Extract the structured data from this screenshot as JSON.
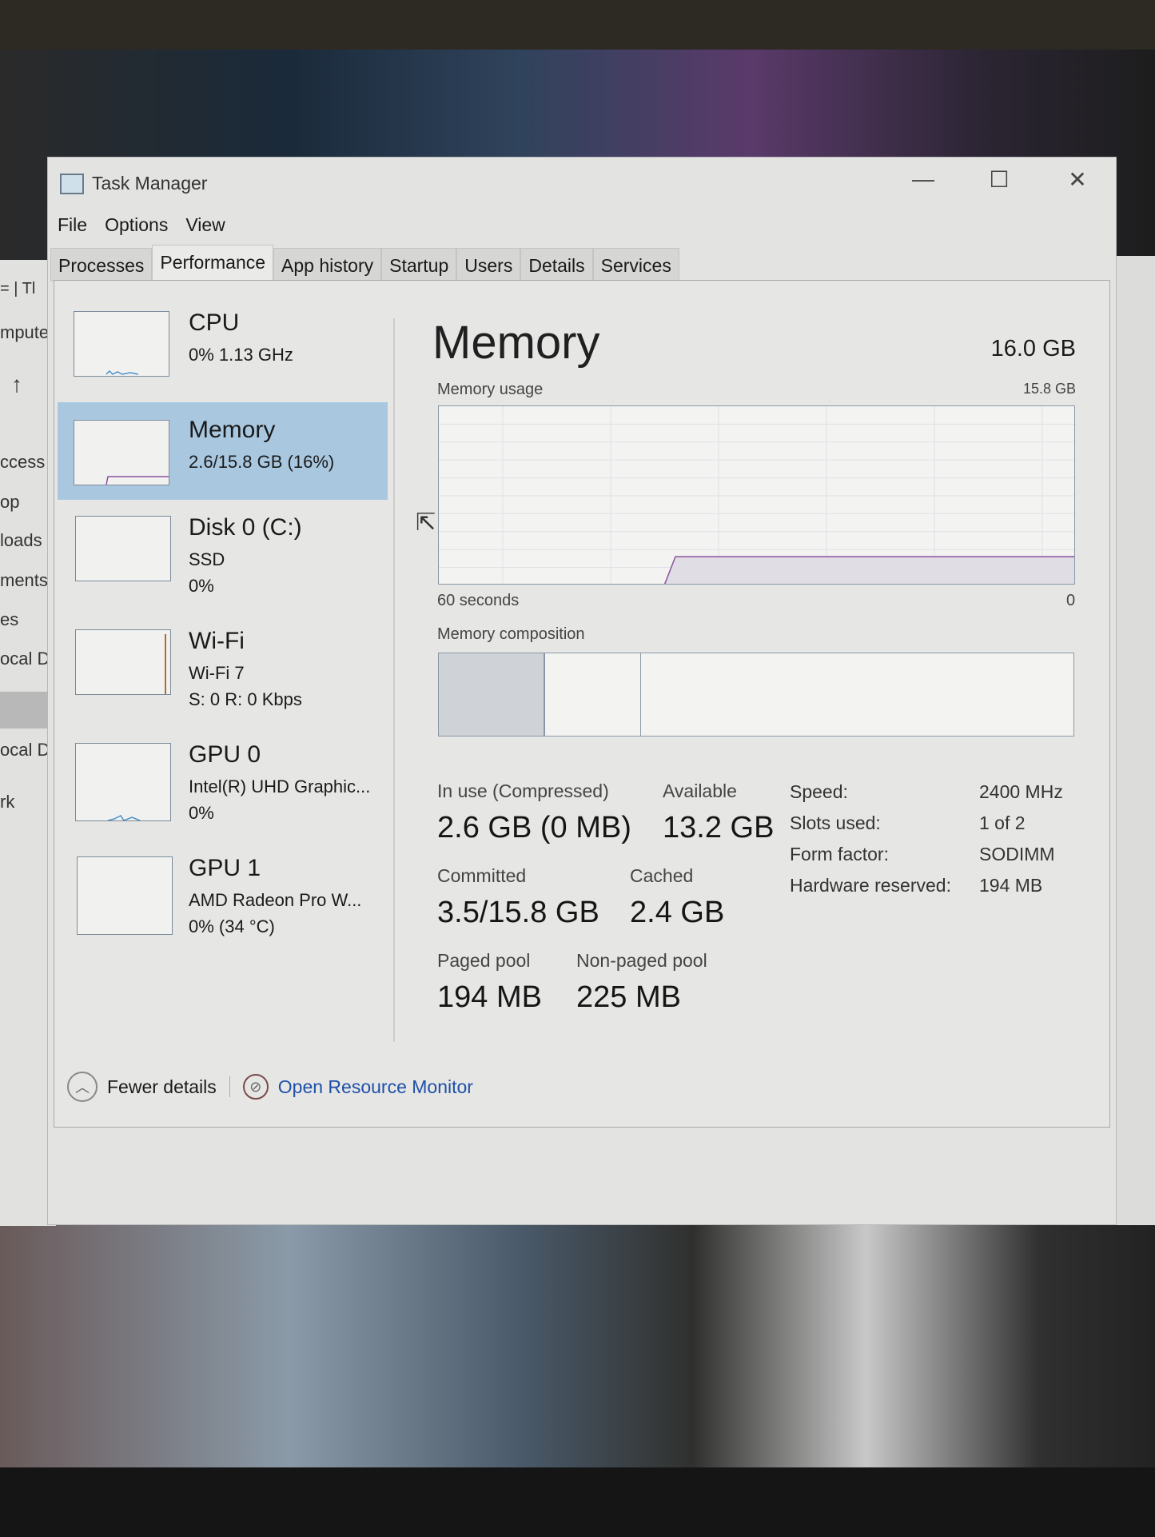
{
  "window": {
    "title": "Task Manager",
    "min": "—",
    "max": "☐",
    "close": "✕"
  },
  "menu": [
    "File",
    "Options",
    "View"
  ],
  "tabs": [
    "Processes",
    "Performance",
    "App history",
    "Startup",
    "Users",
    "Details",
    "Services"
  ],
  "active_tab": "Performance",
  "sidebar": [
    {
      "name": "CPU",
      "lines": [
        "0%  1.13 GHz"
      ]
    },
    {
      "name": "Memory",
      "lines": [
        "2.6/15.8 GB (16%)"
      ],
      "selected": true
    },
    {
      "name": "Disk 0 (C:)",
      "lines": [
        "SSD",
        "0%"
      ]
    },
    {
      "name": "Wi-Fi",
      "lines": [
        "Wi-Fi 7",
        "S: 0 R: 0 Kbps"
      ]
    },
    {
      "name": "GPU 0",
      "lines": [
        "Intel(R) UHD Graphic...",
        "0%"
      ]
    },
    {
      "name": "GPU 1",
      "lines": [
        "AMD Radeon Pro W...",
        "0%  (34 °C)"
      ]
    }
  ],
  "main": {
    "title": "Memory",
    "total": "16.0 GB",
    "usage_label": "Memory usage",
    "usage_max": "15.8 GB",
    "time_left": "60 seconds",
    "time_right": "0",
    "usage_percent": 16,
    "composition_label": "Memory composition",
    "stats": {
      "in_use_label": "In use (Compressed)",
      "in_use": "2.6 GB (0 MB)",
      "available_label": "Available",
      "available": "13.2 GB",
      "committed_label": "Committed",
      "committed": "3.5/15.8 GB",
      "cached_label": "Cached",
      "cached": "2.4 GB",
      "paged_label": "Paged pool",
      "paged": "194 MB",
      "nonpaged_label": "Non-paged pool",
      "nonpaged": "225 MB"
    },
    "specs": [
      {
        "k": "Speed:",
        "v": "2400 MHz"
      },
      {
        "k": "Slots used:",
        "v": "1 of 2"
      },
      {
        "k": "Form factor:",
        "v": "SODIMM"
      },
      {
        "k": "Hardware reserved:",
        "v": "194 MB"
      }
    ]
  },
  "footer": {
    "fewer": "Fewer details",
    "monitor": "Open Resource Monitor"
  },
  "behind": [
    "mpute",
    "ccess",
    "op",
    "loads",
    "ments",
    "es",
    "ocal D",
    "ocal D",
    "rk"
  ],
  "colors": {
    "selected": "#a9c8e0",
    "graph_line": "#8b4fa0",
    "link": "#1e4fa8"
  }
}
